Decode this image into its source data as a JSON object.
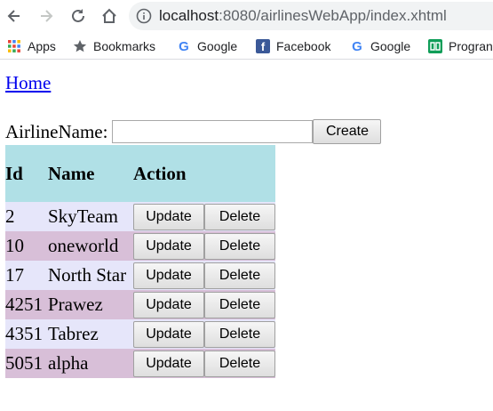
{
  "browser": {
    "url_host": "localhost",
    "url_rest": ":8080/airlinesWebApp/index.xhtml",
    "bookmarks": [
      {
        "label": "Apps",
        "icon": "apps-grid-icon"
      },
      {
        "label": "Bookmarks",
        "icon": "star-icon"
      },
      {
        "label": "Google",
        "icon": "google-icon"
      },
      {
        "label": "Facebook",
        "icon": "facebook-icon"
      },
      {
        "label": "Google",
        "icon": "google-icon"
      },
      {
        "label": "Progran",
        "icon": "book-icon"
      }
    ]
  },
  "page": {
    "home_link": "Home",
    "form": {
      "label": "AirlineName:",
      "value": "",
      "create_label": "Create"
    },
    "table": {
      "headers": {
        "id": "Id",
        "name": "Name",
        "action": "Action"
      },
      "rows": [
        {
          "id": "2",
          "name": "SkyTeam",
          "update": "Update",
          "delete": "Delete"
        },
        {
          "id": "10",
          "name": "oneworld",
          "update": "Update",
          "delete": "Delete"
        },
        {
          "id": "17",
          "name": "North Star",
          "update": "Update",
          "delete": "Delete"
        },
        {
          "id": "4251",
          "name": "Prawez",
          "update": "Update",
          "delete": "Delete"
        },
        {
          "id": "4351",
          "name": "Tabrez",
          "update": "Update",
          "delete": "Delete"
        },
        {
          "id": "5051",
          "name": "alpha",
          "update": "Update",
          "delete": "Delete"
        }
      ]
    }
  },
  "colors": {
    "header_bg": "#b0e0e6",
    "row_odd_bg": "#e6e6fa",
    "row_even_bg": "#d8bfd8",
    "link": "#0000ee"
  }
}
